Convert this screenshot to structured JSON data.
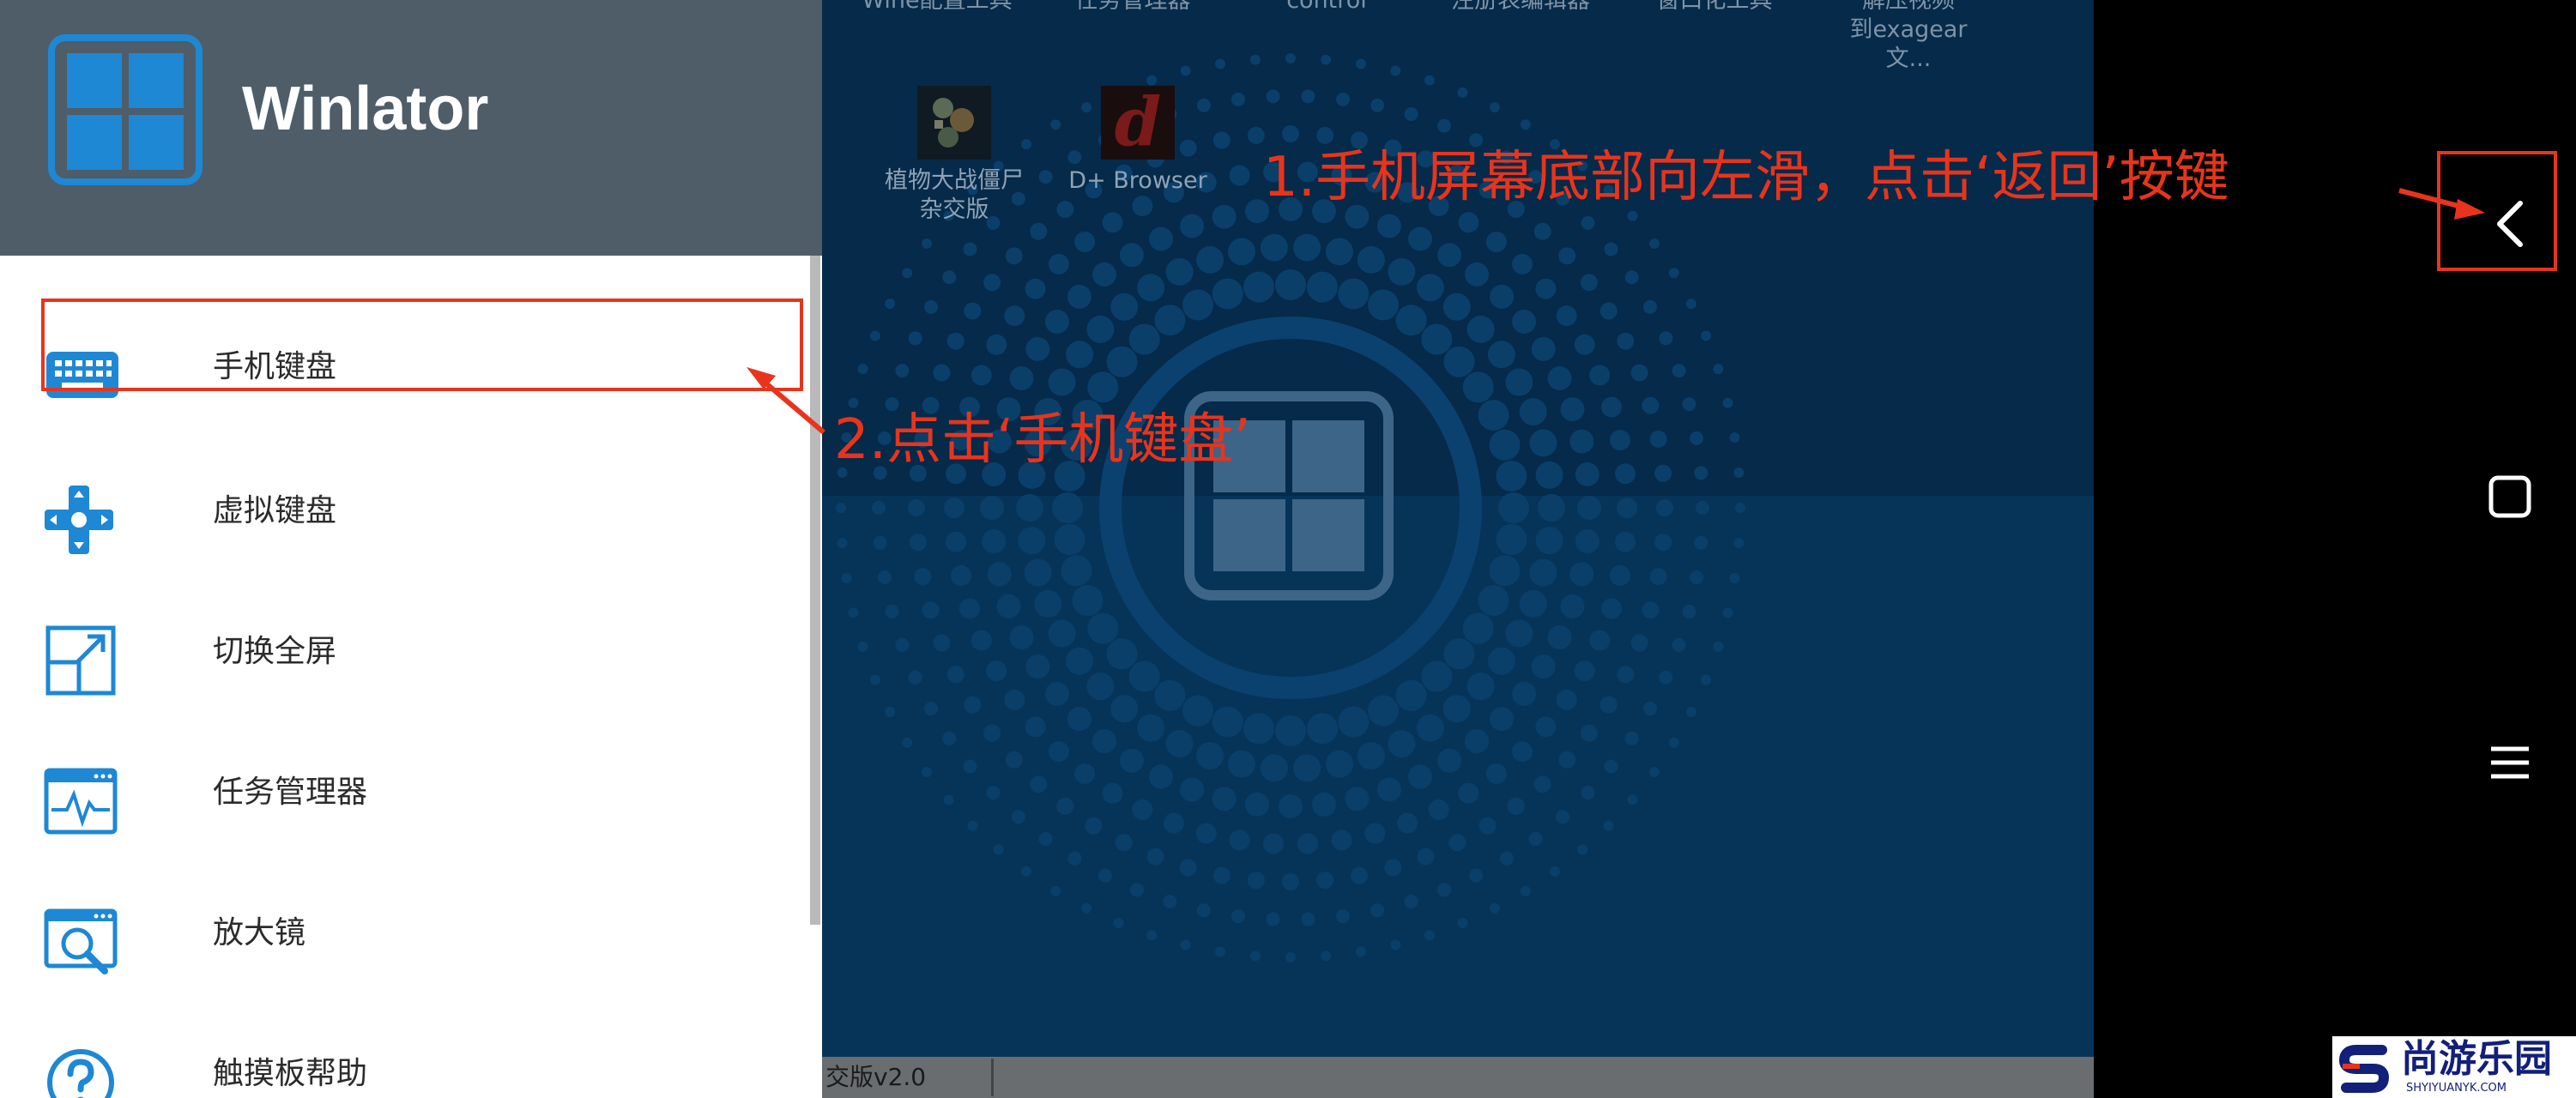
{
  "app": {
    "title": "Winlator"
  },
  "menu": {
    "items": [
      {
        "label": "手机键盘",
        "icon": "keyboard-icon"
      },
      {
        "label": "虚拟键盘",
        "icon": "gamepad-dpad-icon"
      },
      {
        "label": "切换全屏",
        "icon": "fullscreen-icon"
      },
      {
        "label": "任务管理器",
        "icon": "task-manager-icon"
      },
      {
        "label": "放大镜",
        "icon": "magnifier-icon"
      },
      {
        "label": "触摸板帮助",
        "icon": "help-icon"
      }
    ]
  },
  "desktop": {
    "top_row_labels": [
      "Wine配置工具",
      "任务管理器",
      "control",
      "注册表编辑器",
      "窗口化工具",
      "解压视频"
    ],
    "top_row_sublabel": "到exagear文...",
    "icons": [
      {
        "label": "植物大战僵尸杂交版",
        "icon": "pvz-game-icon"
      },
      {
        "label": "D+ Browser",
        "icon": "browser-icon"
      }
    ],
    "taskbar_item": "交版v2.0"
  },
  "navbar": {
    "back": "back-icon",
    "home": "home-icon",
    "recents": "recents-icon"
  },
  "annotations": {
    "step1": "1.手机屏幕底部向左滑，点击‘返回’按键",
    "step2": "2.点击‘手机键盘’"
  },
  "colors": {
    "accent": "#1e88d4",
    "annotation": "#e8341c",
    "header": "#4e5d68",
    "desktop": "#063459"
  },
  "watermark": {
    "name": "尚游乐园",
    "domain": "SHYIYUANYK.COM"
  }
}
